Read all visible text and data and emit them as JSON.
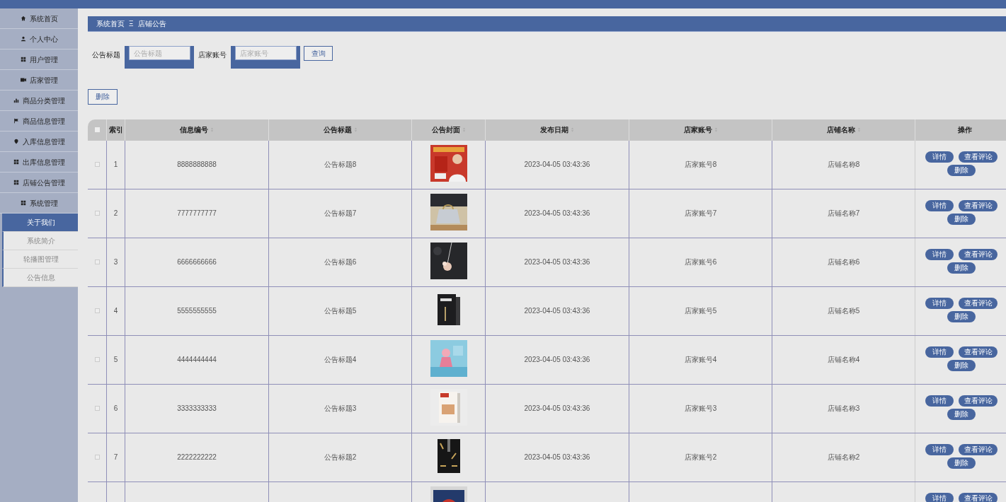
{
  "sidebar": {
    "items": [
      {
        "label": "系统首页"
      },
      {
        "label": "个人中心"
      },
      {
        "label": "用户管理"
      },
      {
        "label": "店家管理"
      },
      {
        "label": "商品分类管理"
      },
      {
        "label": "商品信息管理"
      },
      {
        "label": "入库信息管理"
      },
      {
        "label": "出库信息管理"
      },
      {
        "label": "店铺公告管理"
      },
      {
        "label": "系统管理",
        "expanded": true,
        "children": [
          {
            "label": "关于我们",
            "selected": true
          },
          {
            "label": "系统简介",
            "selected": false
          },
          {
            "label": "轮播图管理",
            "selected": false
          },
          {
            "label": "公告信息",
            "selected": false
          }
        ]
      }
    ]
  },
  "breadcrumb": {
    "home": "系统首页",
    "separator": "Ξ",
    "current": "店铺公告"
  },
  "search": {
    "fields": [
      {
        "label": "公告标题",
        "placeholder": "公告标题"
      },
      {
        "label": "店家账号",
        "placeholder": "店家账号"
      }
    ],
    "button": "查询"
  },
  "toolbar": {
    "delete_button": "删除"
  },
  "table": {
    "header_checked": false,
    "columns": [
      {
        "label": "索引",
        "sortable": false
      },
      {
        "label": "信息编号",
        "sortable": true
      },
      {
        "label": "公告标题",
        "sortable": true
      },
      {
        "label": "公告封面",
        "sortable": true
      },
      {
        "label": "发布日期",
        "sortable": true
      },
      {
        "label": "店家账号",
        "sortable": true
      },
      {
        "label": "店铺名称",
        "sortable": true
      },
      {
        "label": "操作",
        "sortable": false
      }
    ],
    "rows": [
      {
        "checked": false,
        "index": "1",
        "number": "8888888888",
        "title": "公告标题8",
        "cover": {
          "kind": "picture"
        },
        "date": "2023-04-05 03:43:36",
        "account": "店家账号8",
        "shop": "店铺名称8",
        "actions": [
          "详情",
          "查看评论",
          "删除"
        ]
      },
      {
        "checked": false,
        "index": "2",
        "number": "7777777777",
        "title": "公告标题7",
        "cover": {
          "kind": "picture"
        },
        "date": "2023-04-05 03:43:36",
        "account": "店家账号7",
        "shop": "店铺名称7",
        "actions": [
          "详情",
          "查看评论",
          "删除"
        ]
      },
      {
        "checked": false,
        "index": "3",
        "number": "6666666666",
        "title": "公告标题6",
        "cover": {
          "kind": "picture"
        },
        "date": "2023-04-05 03:43:36",
        "account": "店家账号6",
        "shop": "店铺名称6",
        "actions": [
          "详情",
          "查看评论",
          "删除"
        ]
      },
      {
        "checked": false,
        "index": "4",
        "number": "5555555555",
        "title": "公告标题5",
        "cover": {
          "kind": "picture"
        },
        "date": "2023-04-05 03:43:36",
        "account": "店家账号5",
        "shop": "店铺名称5",
        "actions": [
          "详情",
          "查看评论",
          "删除"
        ]
      },
      {
        "checked": false,
        "index": "5",
        "number": "4444444444",
        "title": "公告标题4",
        "cover": {
          "kind": "picture"
        },
        "date": "2023-04-05 03:43:36",
        "account": "店家账号4",
        "shop": "店铺名称4",
        "actions": [
          "详情",
          "查看评论",
          "删除"
        ]
      },
      {
        "checked": false,
        "index": "6",
        "number": "3333333333",
        "title": "公告标题3",
        "cover": {
          "kind": "picture"
        },
        "date": "2023-04-05 03:43:36",
        "account": "店家账号3",
        "shop": "店铺名称3",
        "actions": [
          "详情",
          "查看评论",
          "删除"
        ]
      },
      {
        "checked": false,
        "index": "7",
        "number": "2222222222",
        "title": "公告标题2",
        "cover": {
          "kind": "picture"
        },
        "date": "2023-04-05 03:43:36",
        "account": "店家账号2",
        "shop": "店铺名称2",
        "actions": [
          "详情",
          "查看评论",
          "删除"
        ]
      },
      {
        "cover": {
          "kind": "picture"
        },
        "actions": [
          "详情",
          "查看评论"
        ]
      }
    ]
  }
}
